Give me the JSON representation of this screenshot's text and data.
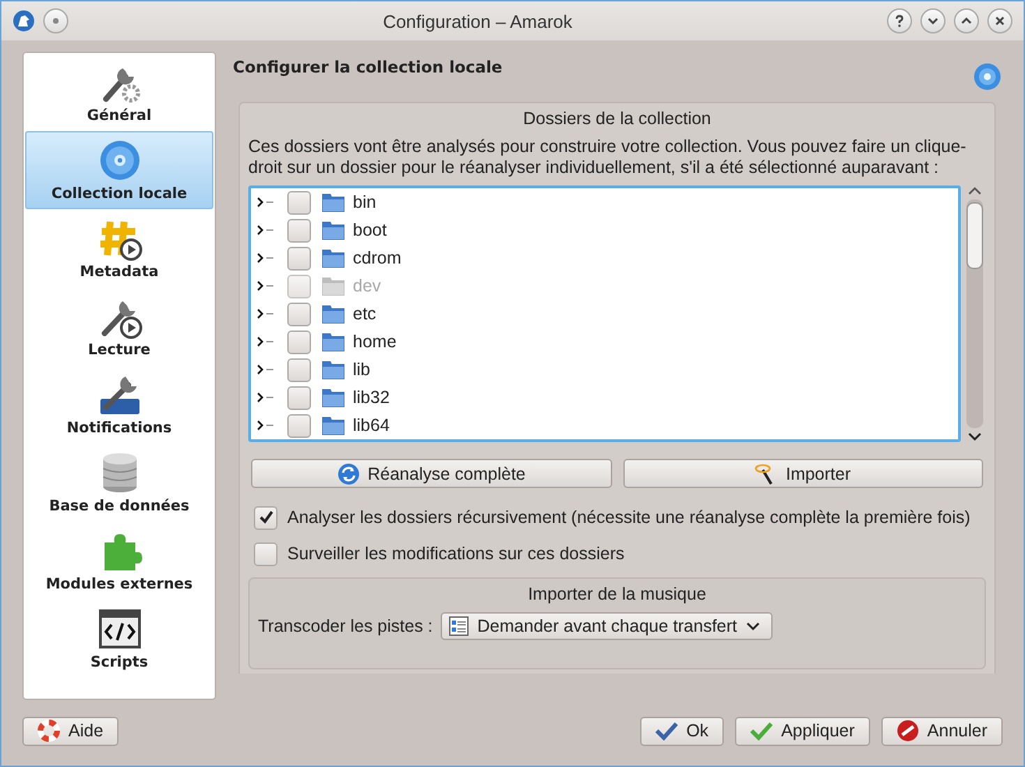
{
  "window": {
    "title": "Configuration – Amarok"
  },
  "sidebar": {
    "items": [
      {
        "label": "Général",
        "selected": false
      },
      {
        "label": "Collection locale",
        "selected": true
      },
      {
        "label": "Metadata",
        "selected": false
      },
      {
        "label": "Lecture",
        "selected": false
      },
      {
        "label": "Notifications",
        "selected": false
      },
      {
        "label": "Base de données",
        "selected": false
      },
      {
        "label": "Modules externes",
        "selected": false
      },
      {
        "label": "Scripts",
        "selected": false
      }
    ]
  },
  "page": {
    "title": "Configurer la collection locale"
  },
  "collection_folders": {
    "title": "Dossiers de la collection",
    "description": "Ces dossiers vont être analysés pour construire votre collection. Vous pouvez faire un clique-droit sur un dossier pour le réanalyser individuellement, s'il a été sélectionné auparavant :",
    "folders": [
      {
        "name": "bin",
        "checked": false,
        "disabled": false
      },
      {
        "name": "boot",
        "checked": false,
        "disabled": false
      },
      {
        "name": "cdrom",
        "checked": false,
        "disabled": false
      },
      {
        "name": "dev",
        "checked": false,
        "disabled": true
      },
      {
        "name": "etc",
        "checked": false,
        "disabled": false
      },
      {
        "name": "home",
        "checked": false,
        "disabled": false
      },
      {
        "name": "lib",
        "checked": false,
        "disabled": false
      },
      {
        "name": "lib32",
        "checked": false,
        "disabled": false
      },
      {
        "name": "lib64",
        "checked": false,
        "disabled": false
      }
    ],
    "buttons": [
      {
        "label": "Réanalyse complète",
        "kind": "rescan"
      },
      {
        "label": "Importer",
        "kind": "import"
      }
    ]
  },
  "options": [
    {
      "label": "Analyser les dossiers récursivement (nécessite une réanalyse complète la première fois)",
      "checked": true
    },
    {
      "label": "Surveiller les modifications sur ces dossiers",
      "checked": false
    }
  ],
  "import_music": {
    "title": "Importer de la musique",
    "transcode_label": "Transcoder les pistes :",
    "transcode_value": "Demander avant chaque transfert"
  },
  "footer": {
    "help": "Aide",
    "actions": [
      {
        "label": "Ok",
        "kind": "ok"
      },
      {
        "label": "Appliquer",
        "kind": "apply"
      },
      {
        "label": "Annuler",
        "kind": "cancel"
      }
    ]
  }
}
